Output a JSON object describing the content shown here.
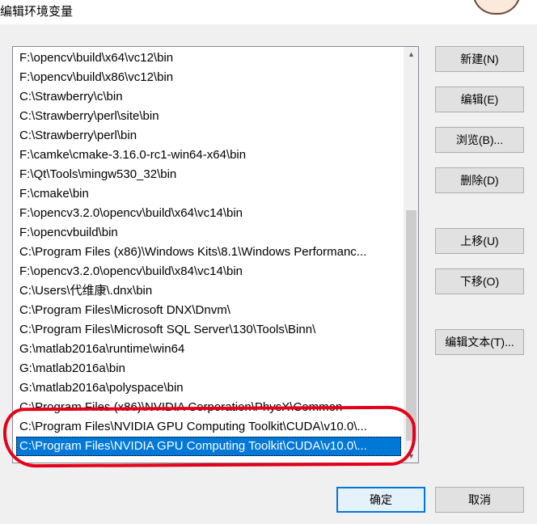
{
  "window": {
    "title": "编辑环境变量"
  },
  "path_list": {
    "items": [
      "F:\\opencv\\build\\x64\\vc12\\bin",
      "F:\\opencv\\build\\x86\\vc12\\bin",
      "C:\\Strawberry\\c\\bin",
      "C:\\Strawberry\\perl\\site\\bin",
      "C:\\Strawberry\\perl\\bin",
      "F:\\camke\\cmake-3.16.0-rc1-win64-x64\\bin",
      "F:\\Qt\\Tools\\mingw530_32\\bin",
      "F:\\cmake\\bin",
      "F:\\opencv3.2.0\\opencv\\build\\x64\\vc14\\bin",
      "F:\\opencvbuild\\bin",
      "C:\\Program Files (x86)\\Windows Kits\\8.1\\Windows Performanc...",
      "F:\\opencv3.2.0\\opencv\\build\\x84\\vc14\\bin",
      "C:\\Users\\代维康\\.dnx\\bin",
      "C:\\Program Files\\Microsoft DNX\\Dnvm\\",
      "C:\\Program Files\\Microsoft SQL Server\\130\\Tools\\Binn\\",
      "G:\\matlab2016a\\runtime\\win64",
      "G:\\matlab2016a\\bin",
      "G:\\matlab2016a\\polyspace\\bin",
      "C:\\Program Files (x86)\\NVIDIA Corporation\\PhysX\\Common",
      "C:\\Program Files\\NVIDIA GPU Computing Toolkit\\CUDA\\v10.0\\...",
      "C:\\Program Files\\NVIDIA GPU Computing Toolkit\\CUDA\\v10.0\\..."
    ],
    "selected_index": 20,
    "scroll_up_icon": "triangle-up",
    "scroll_down_icon": "triangle-down"
  },
  "buttons": {
    "new": "新建(N)",
    "edit": "编辑(E)",
    "browse": "浏览(B)...",
    "delete": "删除(D)",
    "move_up": "上移(U)",
    "move_down": "下移(O)",
    "edit_text": "编辑文本(T)...",
    "ok": "确定",
    "cancel": "取消"
  },
  "colors": {
    "selection": "#0078d7",
    "annotation": "#e3001b",
    "dialog_bg": "#f0f0f0"
  }
}
